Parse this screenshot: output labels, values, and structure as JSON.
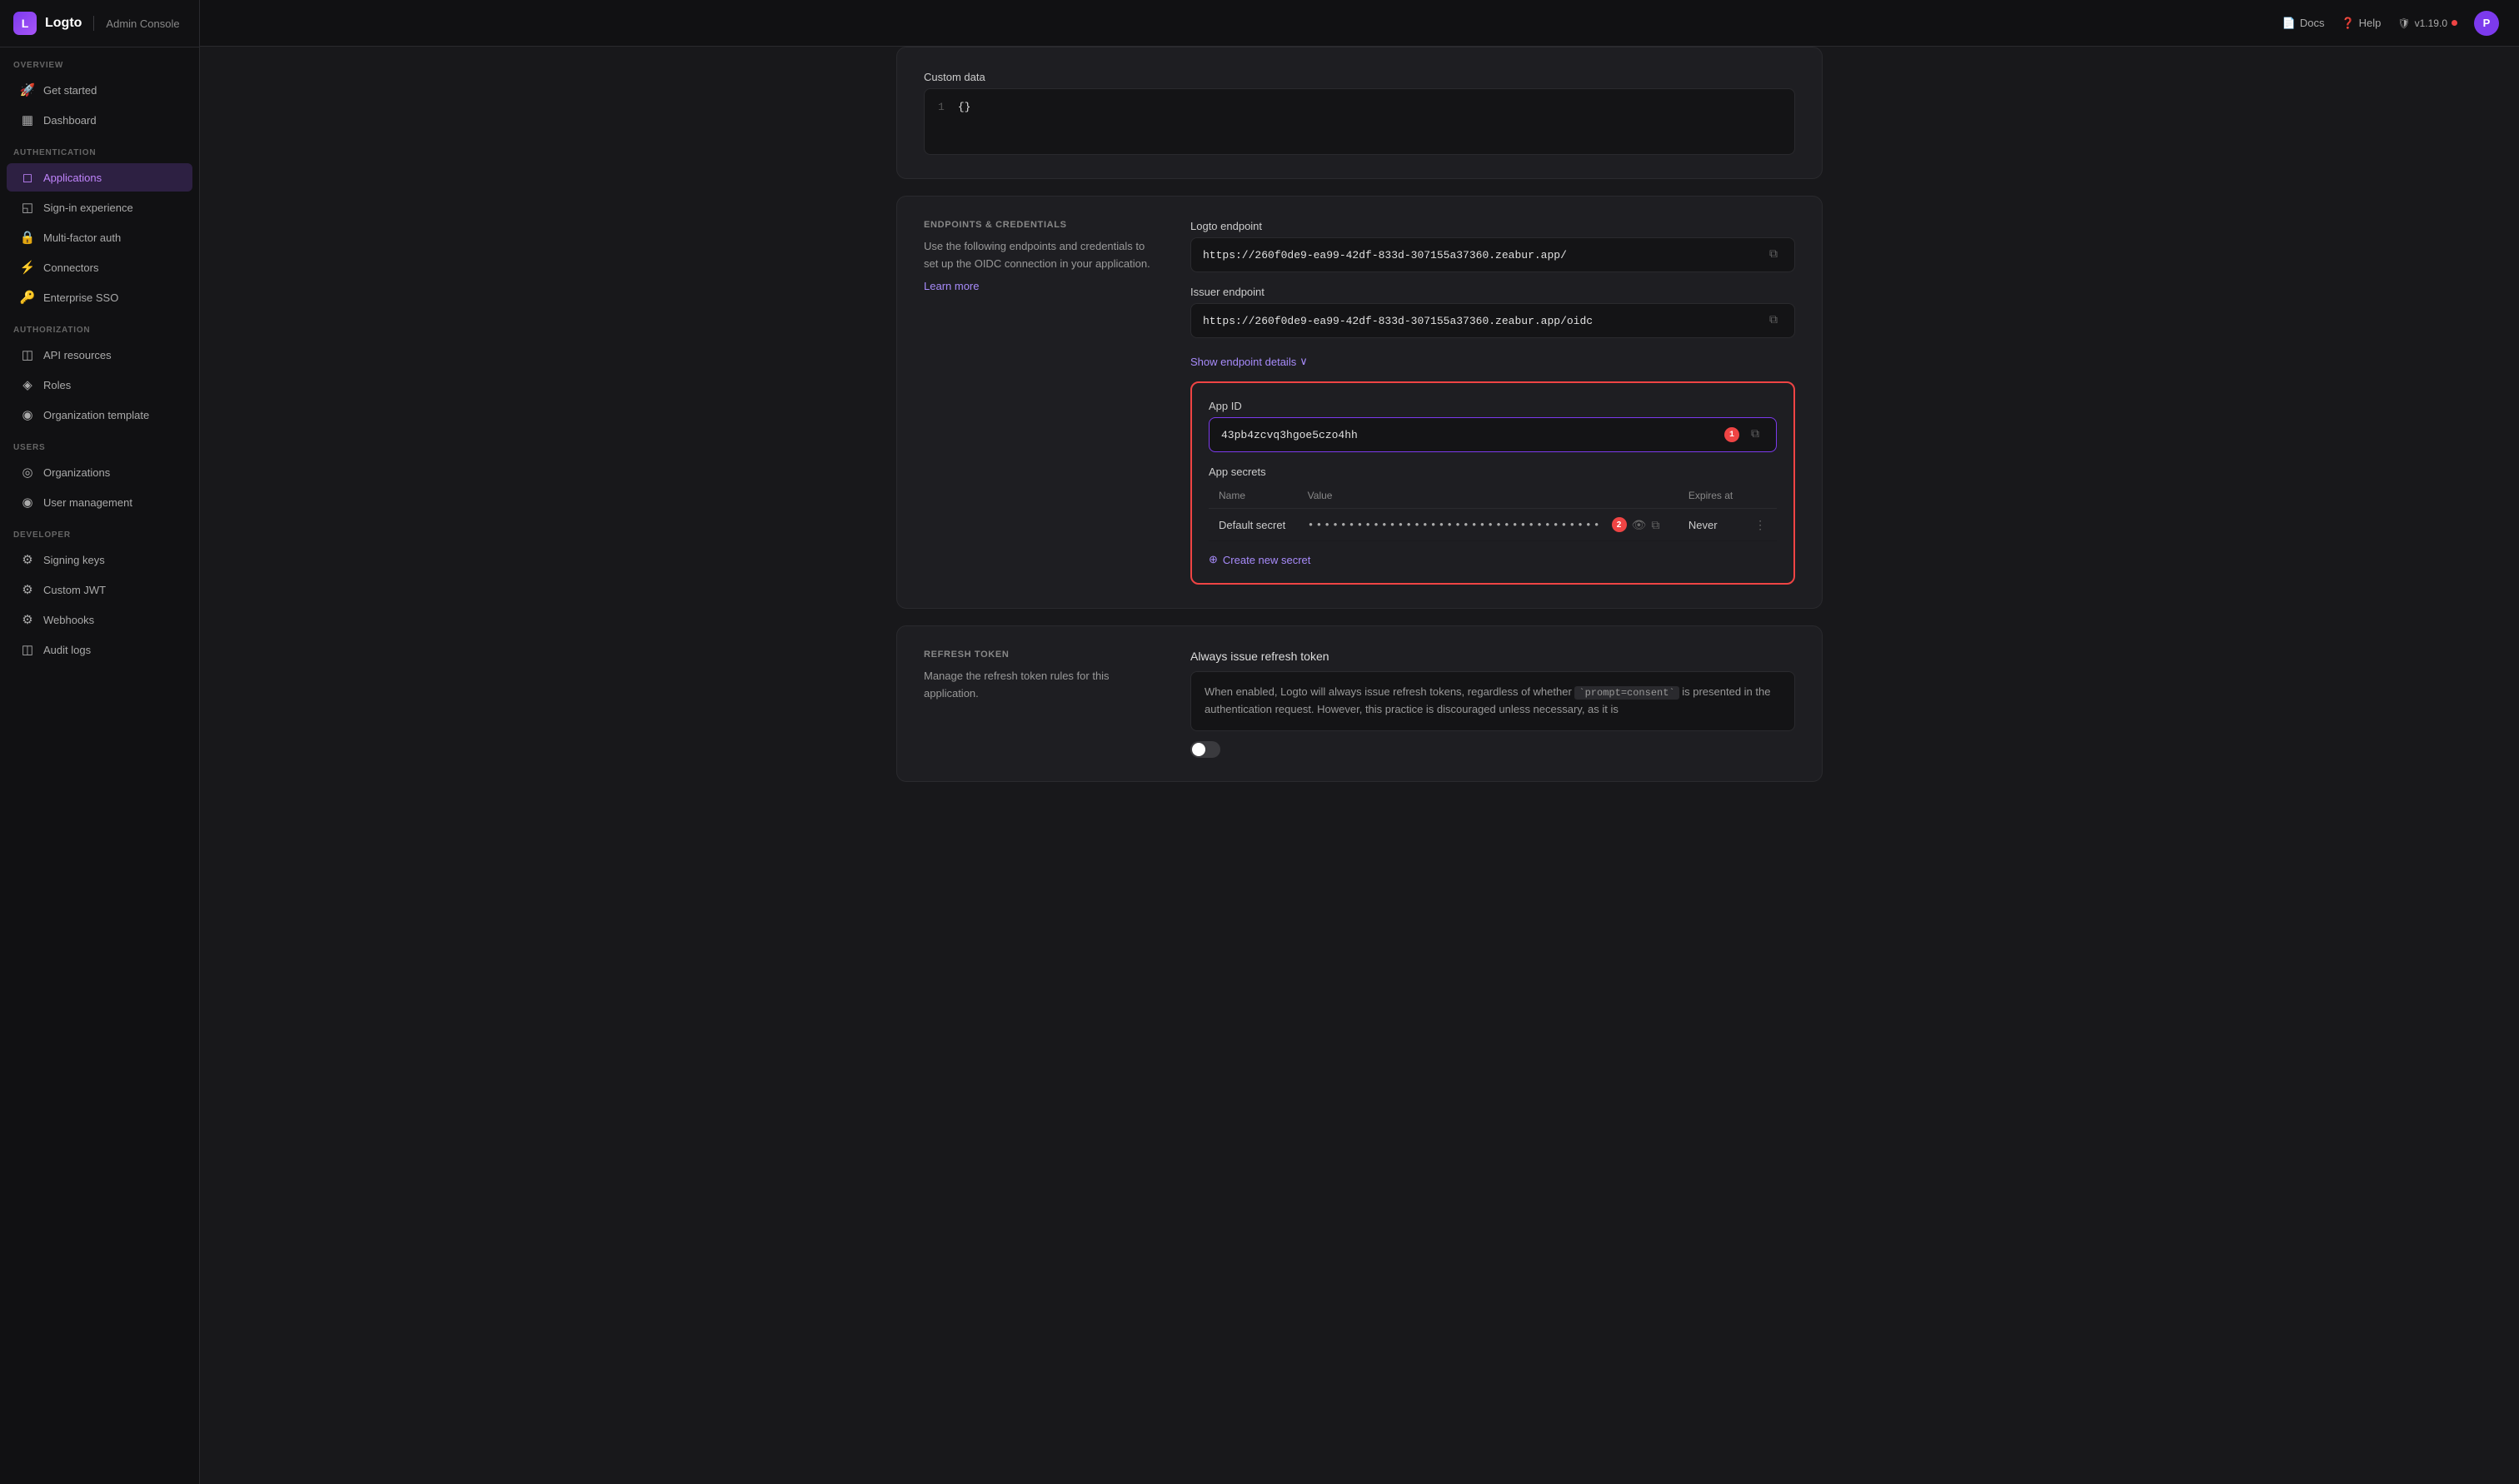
{
  "header": {
    "logo_text": "Logto",
    "console_label": "Admin Console",
    "docs_label": "Docs",
    "help_label": "Help",
    "version": "v1.19.0",
    "avatar_initials": "P"
  },
  "sidebar": {
    "overview_label": "OVERVIEW",
    "overview_items": [
      {
        "id": "get-started",
        "label": "Get started",
        "icon": "🚀"
      },
      {
        "id": "dashboard",
        "label": "Dashboard",
        "icon": "▦"
      }
    ],
    "auth_label": "AUTHENTICATION",
    "auth_items": [
      {
        "id": "applications",
        "label": "Applications",
        "icon": "◻",
        "active": true
      },
      {
        "id": "sign-in",
        "label": "Sign-in experience",
        "icon": "◱"
      },
      {
        "id": "mfa",
        "label": "Multi-factor auth",
        "icon": "🔒"
      },
      {
        "id": "connectors",
        "label": "Connectors",
        "icon": "⚡"
      },
      {
        "id": "enterprise-sso",
        "label": "Enterprise SSO",
        "icon": "🔑"
      }
    ],
    "authz_label": "AUTHORIZATION",
    "authz_items": [
      {
        "id": "api-resources",
        "label": "API resources",
        "icon": "◫"
      },
      {
        "id": "roles",
        "label": "Roles",
        "icon": "◈"
      },
      {
        "id": "org-template",
        "label": "Organization template",
        "icon": "◉"
      }
    ],
    "users_label": "USERS",
    "users_items": [
      {
        "id": "organizations",
        "label": "Organizations",
        "icon": "◎"
      },
      {
        "id": "user-management",
        "label": "User management",
        "icon": "◉"
      }
    ],
    "dev_label": "DEVELOPER",
    "dev_items": [
      {
        "id": "signing-keys",
        "label": "Signing keys",
        "icon": "⚙"
      },
      {
        "id": "custom-jwt",
        "label": "Custom JWT",
        "icon": "⚙"
      },
      {
        "id": "webhooks",
        "label": "Webhooks",
        "icon": "⚙"
      },
      {
        "id": "audit-logs",
        "label": "Audit logs",
        "icon": "◫"
      }
    ]
  },
  "custom_data": {
    "label": "Custom data",
    "line_number": "1",
    "code": "{}"
  },
  "endpoints": {
    "section_title": "ENDPOINTS & CREDENTIALS",
    "description": "Use the following endpoints and credentials to set up the OIDC connection in your application.",
    "learn_more": "Learn more",
    "logto_endpoint_label": "Logto endpoint",
    "logto_endpoint_value": "https://260f0de9-ea99-42df-833d-307155a37360.zeabur.app/",
    "issuer_endpoint_label": "Issuer endpoint",
    "issuer_endpoint_value": "https://260f0de9-ea99-42df-833d-307155a37360.zeabur.app/oidc",
    "show_details_label": "Show endpoint details",
    "app_id_label": "App ID",
    "app_id_value": "43pb4zcvq3hgoe5czo4hh",
    "app_id_badge": "1",
    "app_secrets_label": "App secrets",
    "secrets_cols": [
      "Name",
      "Value",
      "Expires at"
    ],
    "secrets_rows": [
      {
        "name": "Default secret",
        "value": "••••••••••••••••••••••••••••••••••••••",
        "expires": "Never"
      }
    ],
    "secrets_badge": "2",
    "create_secret_label": "Create new secret"
  },
  "refresh_token": {
    "section_title": "REFRESH TOKEN",
    "description": "Manage the refresh token rules for this application.",
    "always_issue_label": "Always issue refresh token",
    "always_issue_desc": "When enabled, Logto will always issue refresh tokens, regardless of whether `prompt=consent` is presented in the authentication request. However, this practice is discouraged unless necessary, as it is",
    "toggle_on": false
  }
}
